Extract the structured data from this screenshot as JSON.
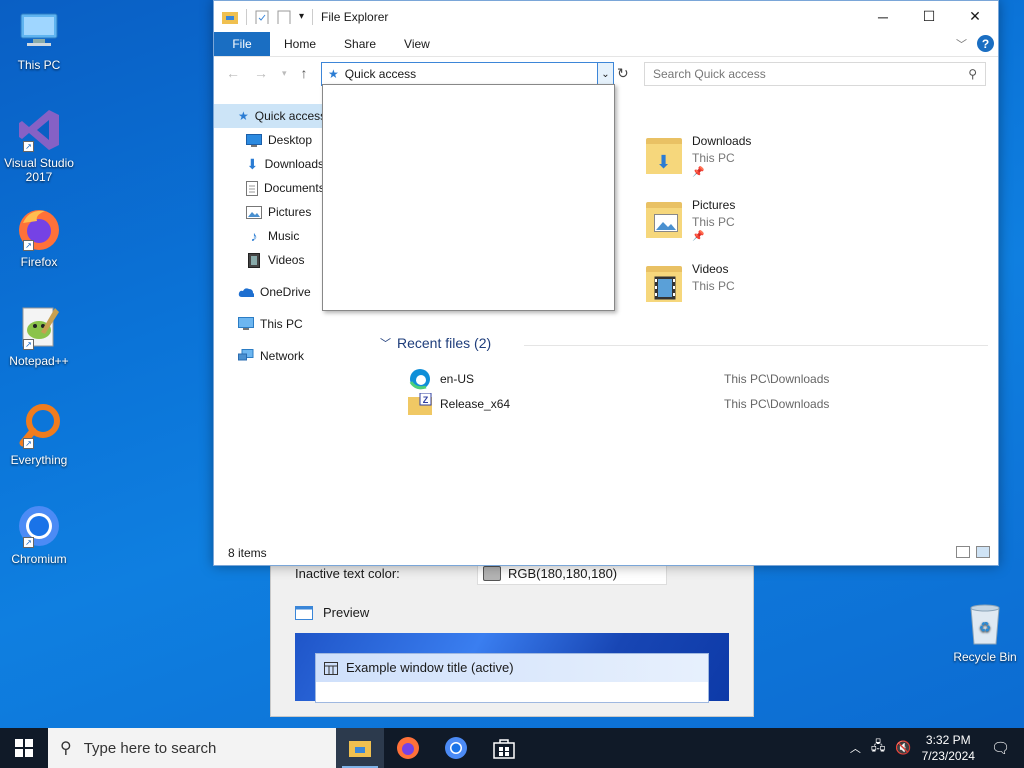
{
  "desktop": {
    "icons": [
      {
        "label": "This PC"
      },
      {
        "label": "Visual Studio 2017"
      },
      {
        "label": "Firefox"
      },
      {
        "label": "Notepad++"
      },
      {
        "label": "Everything"
      },
      {
        "label": "Chromium"
      }
    ],
    "recycle_bin": "Recycle Bin"
  },
  "bg_window": {
    "inactive_text_color_label": "Inactive text color:",
    "inactive_text_color_value": "RGB(180,180,180)",
    "preview_label": "Preview",
    "example_title": "Example window title (active)"
  },
  "explorer": {
    "title": "File Explorer",
    "tabs": [
      "File",
      "Home",
      "Share",
      "View"
    ],
    "address": "Quick access",
    "search_placeholder": "Search Quick access",
    "nav": [
      {
        "label": "Quick access",
        "icon": "star-icon"
      },
      {
        "label": "Desktop",
        "icon": "desktop-icon"
      },
      {
        "label": "Downloads",
        "icon": "download-icon"
      },
      {
        "label": "Documents",
        "icon": "document-icon"
      },
      {
        "label": "Pictures",
        "icon": "pictures-icon"
      },
      {
        "label": "Music",
        "icon": "music-icon"
      },
      {
        "label": "Videos",
        "icon": "videos-icon"
      },
      {
        "label": "OneDrive",
        "icon": "cloud-icon"
      },
      {
        "label": "This PC",
        "icon": "computer-icon"
      },
      {
        "label": "Network",
        "icon": "network-icon"
      }
    ],
    "folders": [
      {
        "name": "Downloads",
        "location": "This PC",
        "pinned": true
      },
      {
        "name": "Pictures",
        "location": "This PC",
        "pinned": true
      },
      {
        "name": "Videos",
        "location": "This PC",
        "pinned": false
      }
    ],
    "recent_header": "Recent files (2)",
    "recent": [
      {
        "name": "en-US",
        "path": "This PC\\Downloads"
      },
      {
        "name": "Release_x64",
        "path": "This PC\\Downloads"
      }
    ],
    "status": "8 items"
  },
  "taskbar": {
    "search_placeholder": "Type here to search",
    "time": "3:32 PM",
    "date": "7/23/2024"
  }
}
